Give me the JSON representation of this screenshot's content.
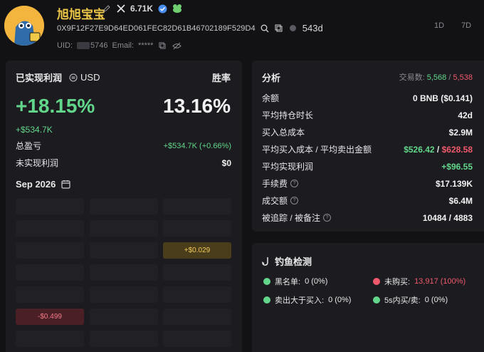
{
  "header": {
    "name": "旭旭宝宝",
    "followers": "6.71K",
    "address": "0X9F12F27E9D64ED061FEC82D61B46702189F529D4",
    "age": "543d",
    "uid_label": "UID:",
    "uid_value": "5746",
    "email_label": "Email:",
    "email_value": "*****",
    "timeframes": [
      "1D",
      "7D"
    ]
  },
  "profit_panel": {
    "title": "已实现利润",
    "currency": "USD",
    "winrate_label": "胜率",
    "realized_pct": "+18.15%",
    "winrate_value": "13.16%",
    "realized_usd": "+$534.7K",
    "total_pnl_label": "总盈亏",
    "total_pnl_value": "+$534.7K (+0.66%)",
    "unrealized_label": "未实现利润",
    "unrealized_value": "$0",
    "month": "Sep 2026",
    "calendar_cells": {
      "pos_value": "+$0.029",
      "neg_value": "-$0.499"
    }
  },
  "analysis": {
    "title": "分析",
    "trades_label": "交易数:",
    "trades_buy": "5,568",
    "trades_sep": "/",
    "trades_sell": "5,538",
    "rows": [
      {
        "label": "余额",
        "value": "0 BNB ($0.141)"
      },
      {
        "label": "平均持仓时长",
        "value": "42d"
      },
      {
        "label": "买入总成本",
        "value": "$2.9M"
      },
      {
        "label": "平均买入成本 / 平均卖出金额",
        "value_buy": "$526.42",
        "value_sep": " / ",
        "value_sell": "$628.58"
      },
      {
        "label": "平均实现利润",
        "value": "+$96.55"
      },
      {
        "label": "手续费",
        "value": "$17.139K"
      },
      {
        "label": "成交额",
        "value": "$6.4M"
      },
      {
        "label": "被追踪 / 被备注",
        "value": "10484 / 4883"
      }
    ]
  },
  "phishing": {
    "title": "钓鱼检测",
    "items": [
      {
        "label": "黑名单:",
        "value": "0 (0%)"
      },
      {
        "label": "未购买:",
        "value": "13,917 (100%)"
      },
      {
        "label": "卖出大于买入:",
        "value": "0 (0%)"
      },
      {
        "label": "5s内买/卖:",
        "value": "0 (0%)"
      }
    ]
  },
  "colors": {
    "green": "#62d68a",
    "red": "#f0596b",
    "gold": "#f0c948"
  }
}
